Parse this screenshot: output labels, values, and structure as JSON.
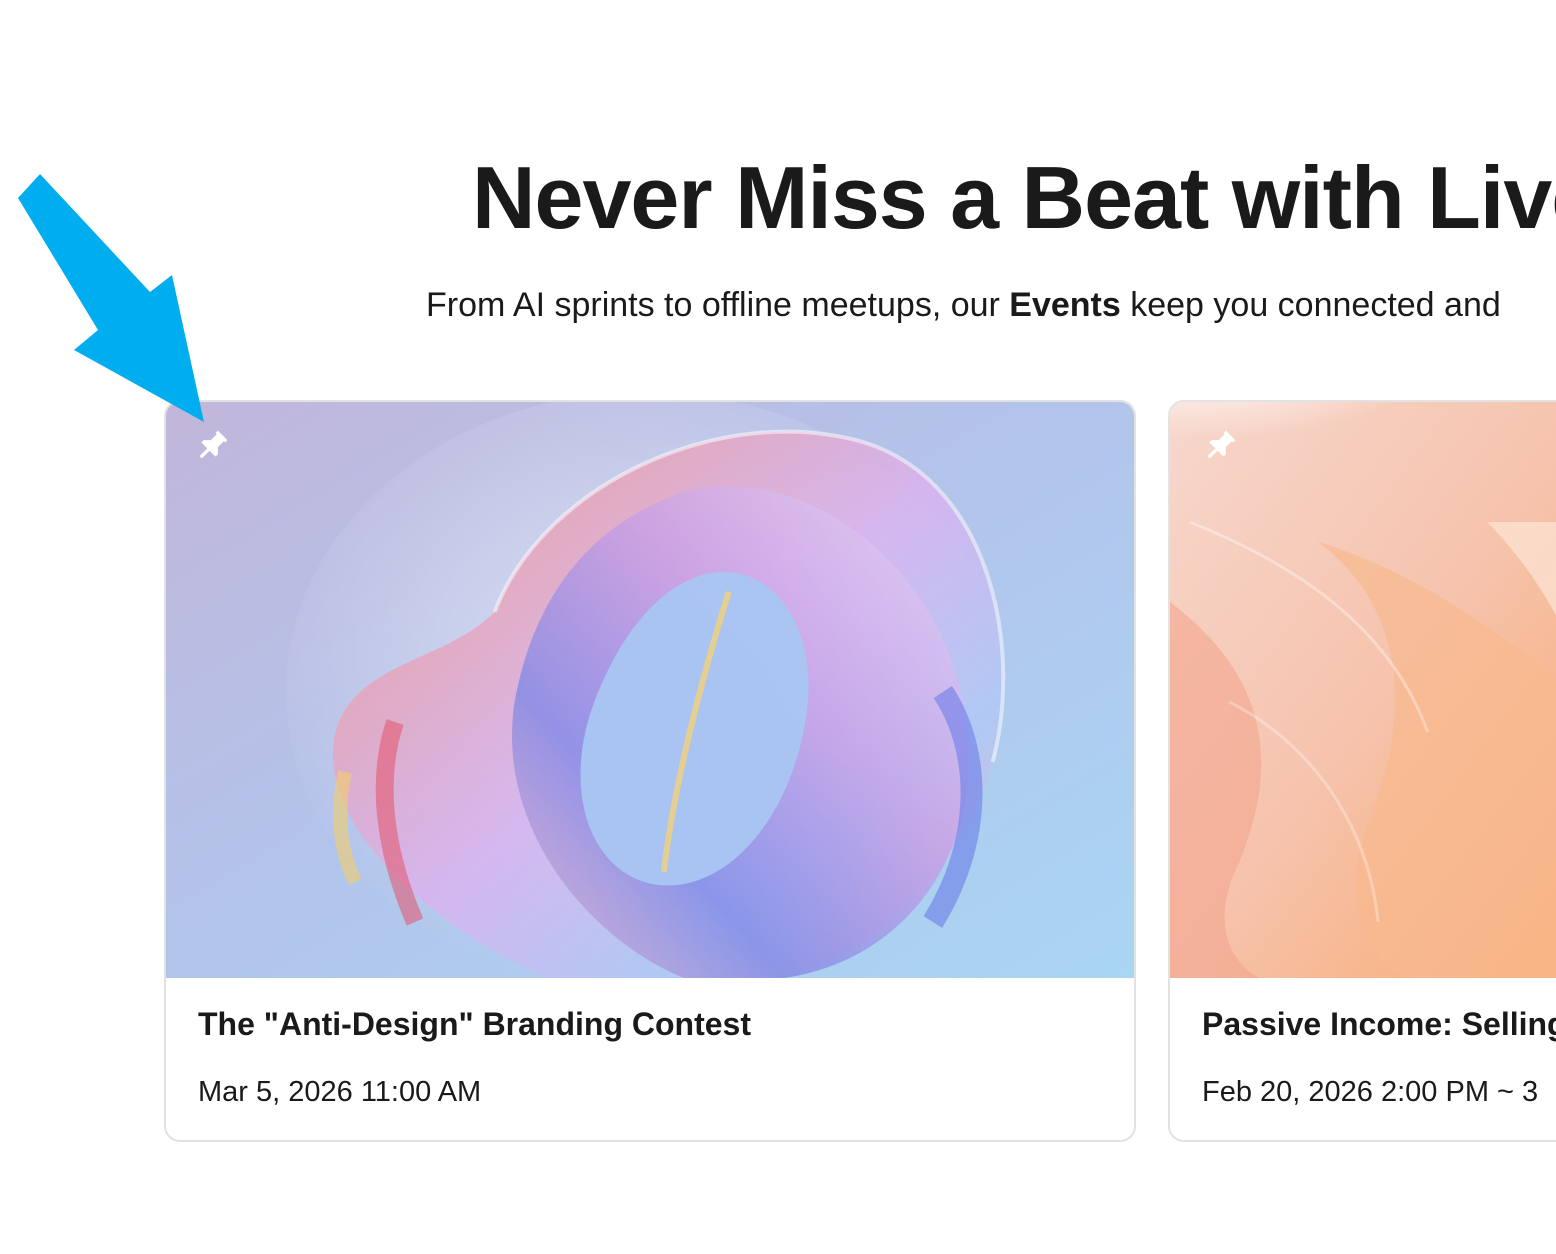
{
  "hero": {
    "title": "Never Miss a Beat with Live",
    "subtitle_before": "From AI sprints to offline meetups, our ",
    "subtitle_bold": "Events",
    "subtitle_after": " keep you connected and"
  },
  "events": [
    {
      "title": "The \"Anti-Design\" Branding Contest",
      "date": "Mar 5, 2026 11:00 AM",
      "pin_icon": "pin-icon"
    },
    {
      "title": "Passive Income: Selling",
      "date": "Feb 20, 2026 2:00 PM ~  3",
      "pin_icon": "pin-icon"
    }
  ],
  "annotation": {
    "arrow_color": "#00aeef"
  }
}
